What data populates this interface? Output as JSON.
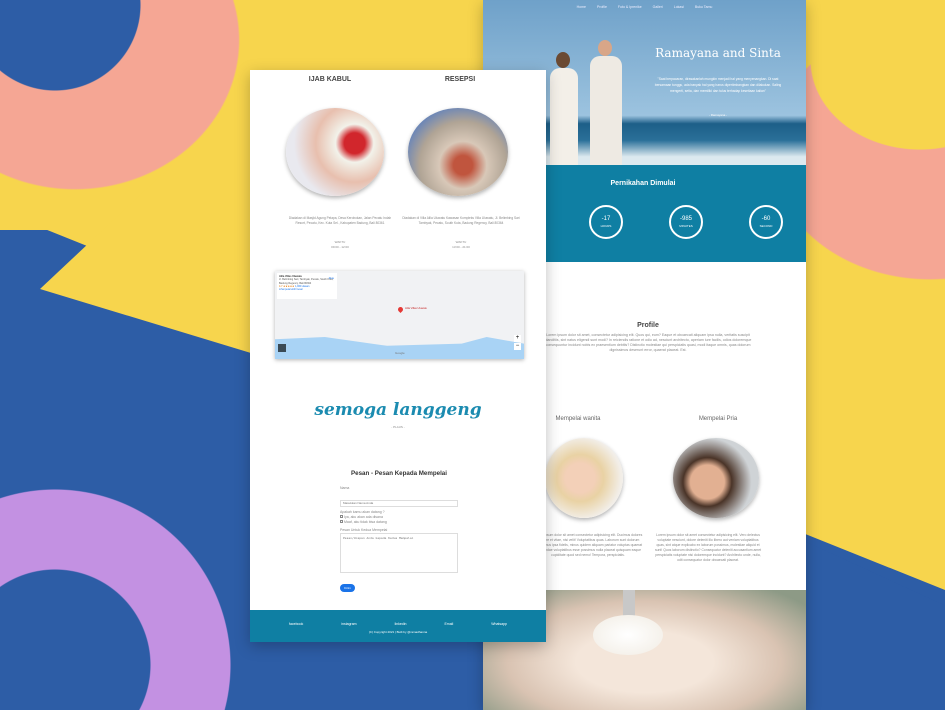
{
  "right_page": {
    "nav": [
      "Home",
      "Profile",
      "Foto & Iprenike",
      "Galleri",
      "Lokasi",
      "Buku Tamu"
    ],
    "hero_title": "Ramayana and Sinta",
    "hero_quote": "\"Saat berpacaran, dirasakanlah mungkin menjadi hal yang menyenangkan. Di saat bersamaan tunggu, ada banyak hal yang harus dipertimbangkan dan dilakukan. Saling mengerti, setia, dan memiliki dan tulus terhadap kesetiaan kalian\"",
    "hero_attr": "- Ramayana -",
    "countdown_title": "Pernikahan Dimulai",
    "countdown": [
      {
        "value": "-17",
        "unit": "HOURS"
      },
      {
        "value": "-985",
        "unit": "MINUTES"
      },
      {
        "value": "-60",
        "unit": "SECOND"
      }
    ],
    "profile_title": "Profile",
    "profile_text": "Lorem ipsum dolor sit amet, consectetur adipisicing elit. Quos qui, eum? Eaque et obcaecati aliquam ipsa nulla, veritatis suscipit blanditiis, sint natus eligendi sunt modi? In reiciendis ratione et odio ad, nesciunt architecto, aperiam iure facilis, odios doloremque consequuntur incidunt nobis ex praesentium debitis? Distinctio molestiae qui perspiciatis quasi, modi itaque omnis, quas dolorum dignissimos deserunt error, quaerat placeat. Est.",
    "bride_title": "Mempelai wanita",
    "groom_title": "Mempelai Pria",
    "bride_text": "Lorem ipsum dolor sit amet consectetur adipisicing elit. Ducimus dolores tempore et vitae, nisi velit! Voluptatibus quas. Laborum sunt dolorum accusamus ipsa fidelis, minus quidem aliquam pariatur voluptas quaerat recusandae voluptatibus esse possimus nulla placeat quisquam eaque cupiditate quod sed nemo! Tempora, perspiciatis.",
    "groom_text": "Lorem ipsum dolor sit amet consectetur adipisicing elit. Vero delectus voluptate nesciunt, dolore deleniti illo libero aut veniam voluptatibus quas, sint atque explicabo ex laborum possimus, molestiae aliquid et sunt! Quos laborum distinctio? Consequatur deleniti accusantium amet perspiciatis voluptate nisi doloremque incidunt? Architecto unde, nulla, odit consequatur dolor obcaecati placeat."
  },
  "left_page": {
    "events": [
      {
        "title": "IJAB KABUL",
        "desc": "Diadakan di Masjid Agung Pelapa, Desa Kerobokan, Jalan Pecatu Indah Resort, Pecatu, Kec. Kuta Sel., Kabupaten Badung, Bali 80361",
        "time_label": "WAKTU",
        "time": "09:00 - 12:00"
      },
      {
        "title": "RESEPSI",
        "desc": "Diadakan di Villa Alila Uluwatu Kawasan Kompleks Villa Uluwatu, Jl. Belimbing Sari Tambyak, Pecatu, South Kuta, Badung Regency, Bali 80364",
        "time_label": "WAKTU",
        "time": "13:00 - 21:00"
      }
    ],
    "map": {
      "place": "Alila Villas Uluwatu",
      "address": "Jl. Belimbing Sari, Tambyak, Pecatu, South Kuta, Badung Regency, Bali 80364",
      "rating": "4.7 ★★★★★",
      "reviews": "1,969 ulasan",
      "larger": "Lihat peta lebih besar",
      "directions": "Rute",
      "pin": "Alila Villas Uluwatu",
      "zoom_in": "+",
      "zoom_out": "−",
      "google": "Google"
    },
    "script_title": "semoga langgeng",
    "script_sub": "- PLAUS -",
    "form": {
      "title": "Pesan - Pesan Kepada Mempelai",
      "name_label": "Nama",
      "name_placeholder": "Masukkan Nama Anda",
      "attend_label": "Apakah kamu akan datang ?",
      "opt_yes": "Iya, aku akan ada disana",
      "opt_no": "Maaf, aku tidak bisa datang",
      "msg_label": "Pesan Untuk Kedua Mempelai",
      "msg_placeholder": "Pesan/Ucapan Anda kepada Kedua Mempelai",
      "submit": "Kirim"
    },
    "footer": {
      "links": [
        "facebook",
        "instagram",
        "linkedin",
        "Email",
        "Whatsapp"
      ],
      "copyright": "(C) Copyright 2021 | Built by @ramadhanna"
    }
  }
}
